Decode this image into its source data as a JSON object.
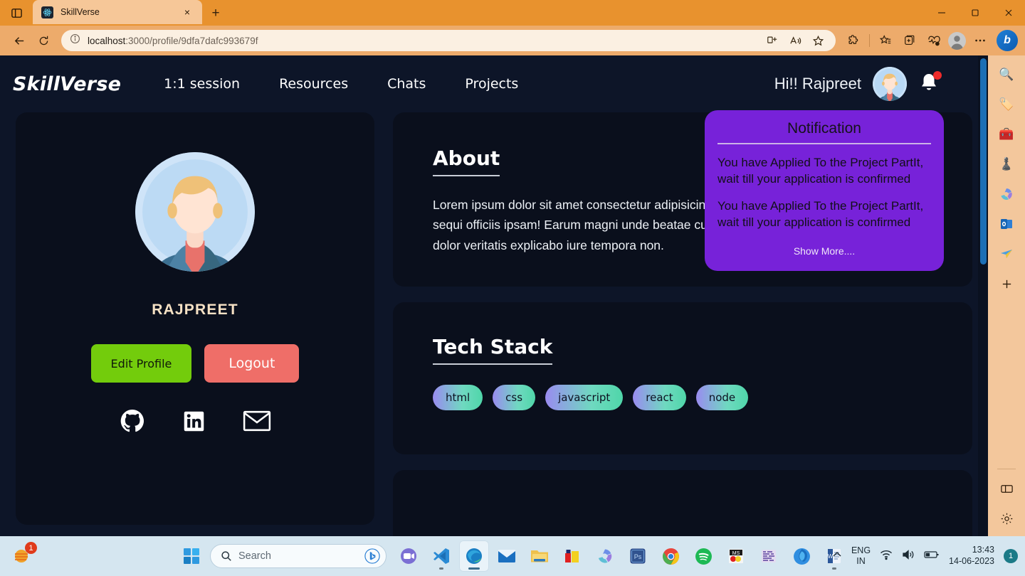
{
  "browser": {
    "tab": {
      "title": "SkillVerse",
      "favicon": "react-icon",
      "close": "×"
    },
    "new_tab_label": "+",
    "window_controls": {
      "minimize": "—",
      "maximize": "❐",
      "close": "✕"
    },
    "omnibox": {
      "url_prefix": "localhost",
      "url_rest": ":3000/profile/9dfa7dafc993679f",
      "info_icon": "info-icon"
    },
    "toolbar_icons": [
      "tab-actions-icon",
      "back-arrow-icon",
      "refresh-icon",
      "split-screen-icon",
      "read-aloud-icon",
      "favorite-star-icon",
      "extensions-icon",
      "favorites-icon",
      "collections-icon",
      "browser-essentials-icon",
      "profile-icon",
      "settings-more-icon",
      "copilot-icon"
    ],
    "sidebar_icons": [
      "search-icon",
      "shopping-icon",
      "tools-icon",
      "games-icon",
      "office-icon",
      "outlook-icon",
      "drop-icon",
      "add-icon",
      "split-pane-icon",
      "gear-icon"
    ]
  },
  "site": {
    "logo": "SkillVerse",
    "nav": [
      {
        "label": "1:1 session"
      },
      {
        "label": "Resources"
      },
      {
        "label": "Chats"
      },
      {
        "label": "Projects"
      }
    ],
    "greeting": "Hi!! Rajpreet",
    "avatar": "user-avatar",
    "bell": "notification-bell-icon"
  },
  "profile": {
    "name": "RAJPREET",
    "edit_button": "Edit Profile",
    "logout_button": "Logout",
    "socials": [
      {
        "name": "github-icon"
      },
      {
        "name": "linkedin-icon"
      },
      {
        "name": "email-icon"
      }
    ]
  },
  "about": {
    "title": "About",
    "text": "Lorem ipsum dolor sit amet consectetur adipisicing elit. Quo doloremque illum sequi officiis ipsam! Earum magni unde beatae cum obcaecati, facere nostrum, dolor veritatis explicabo iure tempora non."
  },
  "tech_stack": {
    "title": "Tech Stack",
    "items": [
      "html",
      "css",
      "javascript",
      "react",
      "node"
    ]
  },
  "notification": {
    "title": "Notification",
    "items": [
      "You have Applied To the Project PartIt, wait till your application is confirmed",
      "You have Applied To the Project PartIt, wait till your application is confirmed"
    ],
    "show_more": "Show More...."
  },
  "taskbar": {
    "weather_badge": "1",
    "search_placeholder": "Search",
    "apps": [
      {
        "name": "teams-icon"
      },
      {
        "name": "vscode-icon"
      },
      {
        "name": "edge-icon"
      },
      {
        "name": "mail-icon"
      },
      {
        "name": "file-explorer-icon"
      },
      {
        "name": "store-icon"
      },
      {
        "name": "office-icon"
      },
      {
        "name": "photoshop-icon"
      },
      {
        "name": "chrome-icon"
      },
      {
        "name": "spotify-icon"
      },
      {
        "name": "paint-icon"
      },
      {
        "name": "code-icon"
      },
      {
        "name": "firefox-icon"
      },
      {
        "name": "word-icon"
      }
    ],
    "language": {
      "line1": "ENG",
      "line2": "IN"
    },
    "clock": {
      "time": "13:43",
      "date": "14-06-2023"
    },
    "tray_badge": "1"
  },
  "colors": {
    "browser_accent": "#e8922e",
    "page_bg": "#0d1528",
    "card_bg": "#0a0f1c",
    "notification_purple": "#7722d9",
    "edit_green": "#73cc0c",
    "logout_red": "#ef6e68",
    "name_cream": "#f6e1c4",
    "scrollbar_blue": "#1c6fb5"
  }
}
